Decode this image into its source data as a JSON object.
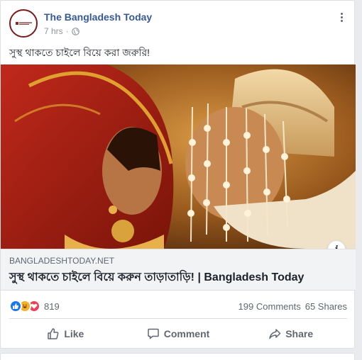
{
  "post": {
    "page_name": "The Bangladesh Today",
    "time": "7 hrs",
    "separator": "·",
    "privacy_icon": "globe-icon",
    "text": "সুস্থ থাকতে চাইলে বিয়ে করা জরুরি!"
  },
  "link": {
    "domain": "BANGLADESHTODAY.NET",
    "title": "সুস্থ থাকতে চাইলে বিয়ে করুন তাড়াতাড়ি! | Bangladesh Today",
    "info_label": "i"
  },
  "stats": {
    "reaction_icons": [
      "like-icon",
      "haha-icon",
      "love-icon"
    ],
    "reaction_count": "819",
    "comments": "199 Comments",
    "shares": "65 Shares"
  },
  "actions": {
    "like": "Like",
    "comment": "Comment",
    "share": "Share"
  },
  "colors": {
    "link_blue": "#365899",
    "like_blue": "#1877f2",
    "haha_yellow": "#f7b125",
    "love_red": "#f33e58"
  }
}
